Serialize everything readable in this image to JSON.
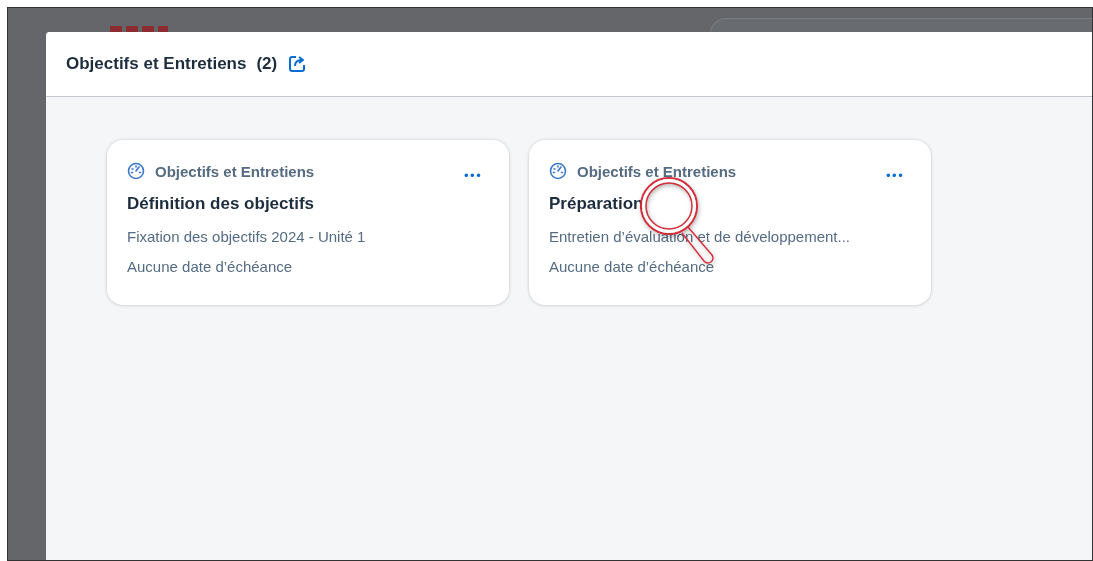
{
  "dialog": {
    "title": "Objectifs et Entretiens",
    "count": "(2)"
  },
  "cards": [
    {
      "category": "Objectifs et Entretiens",
      "more": "•••",
      "title": "Définition des objectifs",
      "description": "Fixation des objectifs 2024 - Unité 1",
      "due": "Aucune date d’échéance",
      "magnified": false
    },
    {
      "category": "Objectifs et Entretiens",
      "more": "•••",
      "title": "Préparation",
      "description": "Entretien d’évaluation et de développement...",
      "due": "Aucune date d’échéance",
      "magnified": true
    }
  ]
}
